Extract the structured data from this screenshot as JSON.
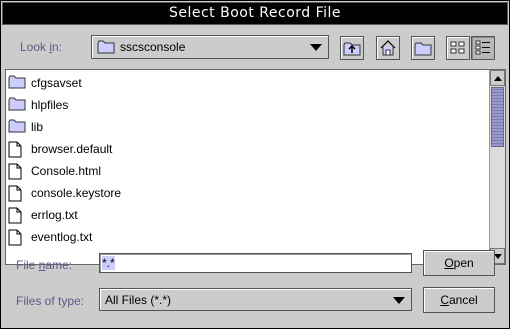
{
  "window": {
    "title": "Select Boot Record File"
  },
  "look_in": {
    "label_pre": "Look ",
    "label_mnemonic": "i",
    "label_post": "n:",
    "value": "sscsconsole"
  },
  "toolbar": {
    "up_icon": "up-folder-icon",
    "home_icon": "home-icon",
    "new_folder_icon": "new-folder-icon",
    "list_view_icon": "list-view-icon",
    "details_view_icon": "details-view-icon"
  },
  "files": [
    {
      "name": "cfgsavset",
      "type": "folder"
    },
    {
      "name": "hlpfiles",
      "type": "folder"
    },
    {
      "name": "lib",
      "type": "folder"
    },
    {
      "name": "browser.default",
      "type": "file"
    },
    {
      "name": "Console.html",
      "type": "file"
    },
    {
      "name": "console.keystore",
      "type": "file"
    },
    {
      "name": "errlog.txt",
      "type": "file"
    },
    {
      "name": "eventlog.txt",
      "type": "file"
    }
  ],
  "file_name": {
    "label_pre": "File ",
    "label_mnemonic": "n",
    "label_post": "ame:",
    "value": "*.*"
  },
  "files_of_type": {
    "label": "Files of type:",
    "value": "All Files (*.*)"
  },
  "buttons": {
    "open_mnemonic": "O",
    "open_rest": "pen",
    "cancel_mnemonic": "C",
    "cancel_rest": "ancel"
  },
  "colors": {
    "label": "#5b5b8a",
    "thumb": "#9999cc",
    "selection": "#ccccff"
  }
}
